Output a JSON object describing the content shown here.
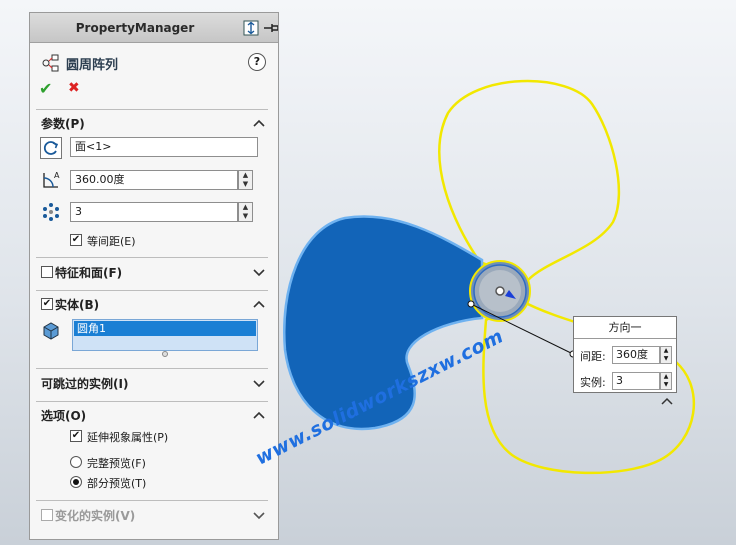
{
  "panel": {
    "title": "PropertyManager",
    "feature_title": "圆周阵列",
    "help": "?"
  },
  "actions": {
    "ok": "✔",
    "cancel": "✖"
  },
  "params": {
    "title": "参数(P)",
    "axis_value": "面<1>",
    "angle_value": "360.00度",
    "count_value": "3",
    "equal_spacing_label": "等间距(E)",
    "equal_spacing_checked": true
  },
  "features_faces": {
    "title": "特征和面(F)",
    "checked": false
  },
  "bodies": {
    "title": "实体(B)",
    "checked": true,
    "selected_item": "圆角1"
  },
  "skip_instances": {
    "title": "可跳过的实例(I)"
  },
  "options": {
    "title": "选项(O)",
    "propagate_visual_label": "延伸视象属性(P)",
    "propagate_visual_checked": true,
    "full_preview_label": "完整预览(F)",
    "partial_preview_label": "部分预览(T)",
    "selected_preview": "partial"
  },
  "vary_instances": {
    "title": "变化的实例(V)",
    "checked": false
  },
  "callout": {
    "title": "方向一",
    "spacing_label": "间距:",
    "spacing_value": "360度",
    "instances_label": "实例:",
    "instances_value": "3"
  },
  "watermark": "www.solidworkszxw.com",
  "colors": {
    "blade_selected": "#1264b8",
    "blade_preview": "#f2e800",
    "accent": "#1a7fd4"
  }
}
